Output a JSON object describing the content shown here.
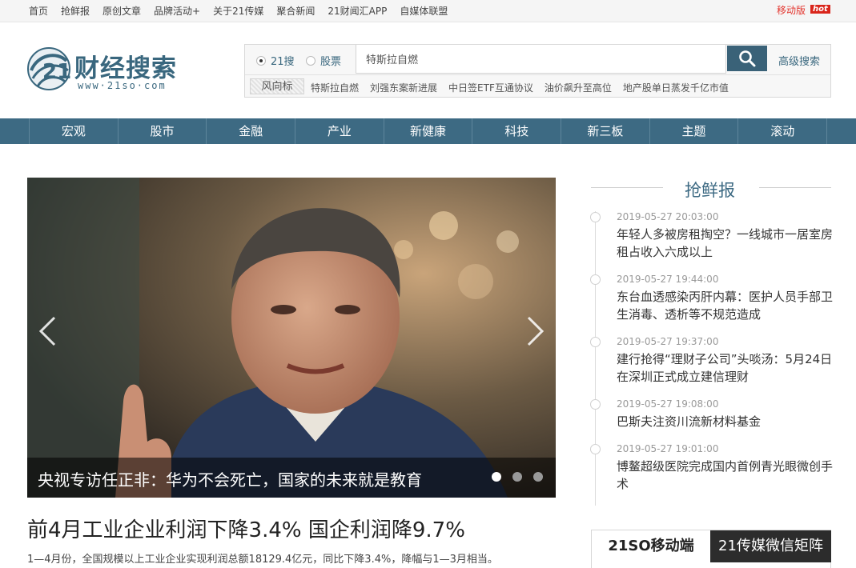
{
  "top_nav": [
    "首页",
    "抢鲜报",
    "原创文章",
    "品牌活动+",
    "关于21传媒",
    "聚合新闻",
    "21财闻汇APP",
    "自媒体联盟"
  ],
  "mobile": {
    "label": "移动版",
    "badge": "hot"
  },
  "logo": {
    "title": "财经搜索",
    "url": "www·21so·com"
  },
  "search": {
    "options": [
      "21搜",
      "股票"
    ],
    "selected": "21搜",
    "value": "特斯拉自燃",
    "advanced_label": "高级搜索",
    "wind_label": "风向标",
    "hot_keywords": [
      "特斯拉自燃",
      "刘强东案新进展",
      "中日签ETF互通协议",
      "油价飙升至高位",
      "地产股单日蒸发千亿市值"
    ]
  },
  "main_nav": [
    "宏观",
    "股市",
    "金融",
    "产业",
    "新健康",
    "科技",
    "新三板",
    "主题",
    "滚动"
  ],
  "carousel": {
    "caption": "央视专访任正非：华为不会死亡，国家的未来就是教育",
    "slide_count": 3,
    "active_slide": 1,
    "prev_icon": "chevron-left-icon",
    "next_icon": "chevron-right-icon"
  },
  "headline": "前4月工业企业利润下降3.4% 国企利润降9.7%",
  "summary": "1—4月份，全国规模以上工业企业实现利润总额18129.4亿元，同比下降3.4%，降幅与1—3月相当。",
  "news": {
    "title": "抢鲜报",
    "items": [
      {
        "time": "2019-05-27 20:03:00",
        "text": "年轻人多被房租掏空？一线城市一居室房租占收入六成以上"
      },
      {
        "time": "2019-05-27 19:44:00",
        "text": "东台血透感染丙肝内幕：医护人员手部卫生消毒、透析等不规范造成"
      },
      {
        "time": "2019-05-27 19:37:00",
        "text": "建行抢得“理财子公司”头啖汤：5月24日在深圳正式成立建信理财"
      },
      {
        "time": "2019-05-27 19:08:00",
        "text": "巴斯夫注资川流新材料基金"
      },
      {
        "time": "2019-05-27 19:01:00",
        "text": "博鳌超级医院完成国内首例青光眼微创手术"
      }
    ]
  },
  "tabs": [
    "21SO移动端",
    "21传媒微信矩阵"
  ],
  "colors": {
    "brand": "#3d6a83",
    "hot_red": "#d9251b",
    "tab_dark": "#2c2c2c"
  }
}
